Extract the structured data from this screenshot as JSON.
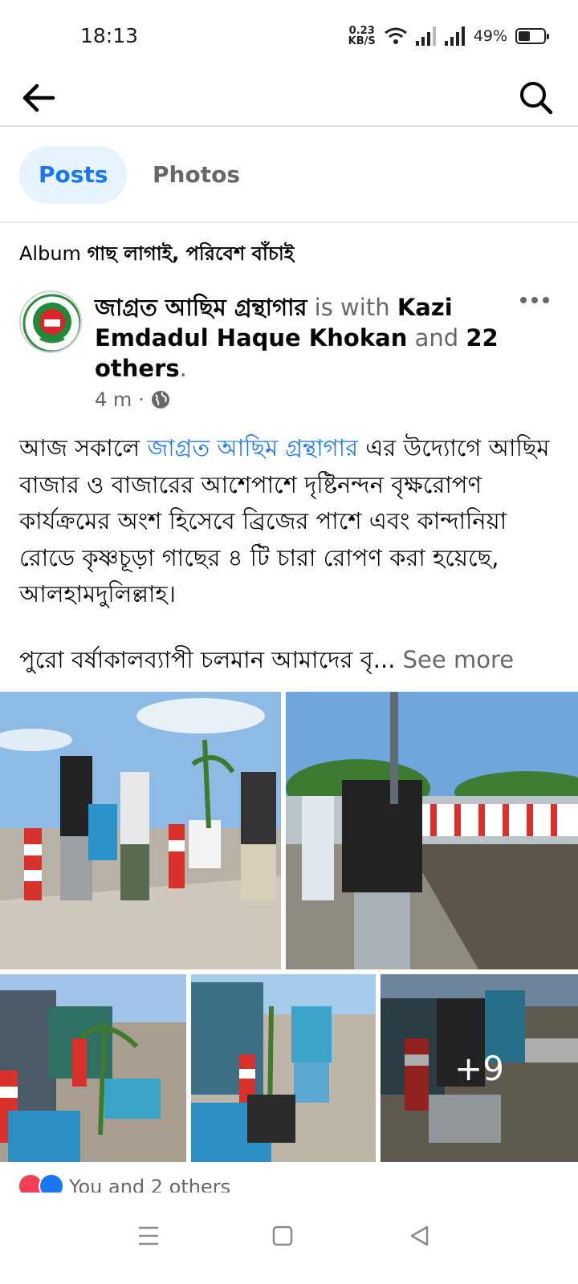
{
  "status_bar": {
    "time": "18:13",
    "net_speed_value": "0.23",
    "net_speed_unit": "KB/S",
    "battery": "49%",
    "battery_level": 0.49
  },
  "tabs": [
    {
      "label": "Posts",
      "active": true
    },
    {
      "label": "Photos",
      "active": false
    }
  ],
  "album": {
    "prefix": "Album",
    "name": "গাছ লাগাই, পরিবেশ বাঁচাই"
  },
  "post": {
    "author": "জাগ্রত আছিম গ্রন্থাগার",
    "with_text": " is with ",
    "tagged": "Kazi Emdadul Haque Khokan",
    "and_text": " and ",
    "others": "22 others",
    "period": ".",
    "time": "4 m",
    "privacy_separator": "·",
    "text_prefix": "আজ সকালে ",
    "text_link": "জাগ্রত আছিম গ্রন্থাগার",
    "text_body": " এর উদ্যোগে আছিম বাজার ও বাজারের আশেপাশে দৃষ্টিনন্দন বৃক্ষরোপণ কার্যক্রমের অংশ হিসেবে ব্রিজের পাশে এবং কান্দানিয়া রোডে কৃষ্ণচূড়া গাছের ৪ টি চারা রোপণ করা হয়েছে, আলহামদুলিল্লাহ।",
    "text_line2": "পুরো বর্ষাকালব্যাপী চলমান আমাদের বৃ...",
    "see_more": "See more",
    "more_photos": "+9",
    "reactions_text": "You and 2 others"
  },
  "colors": {
    "accent": "#1877f2",
    "active_tab_bg": "#e7f3ff",
    "secondary_text": "#65676b"
  }
}
